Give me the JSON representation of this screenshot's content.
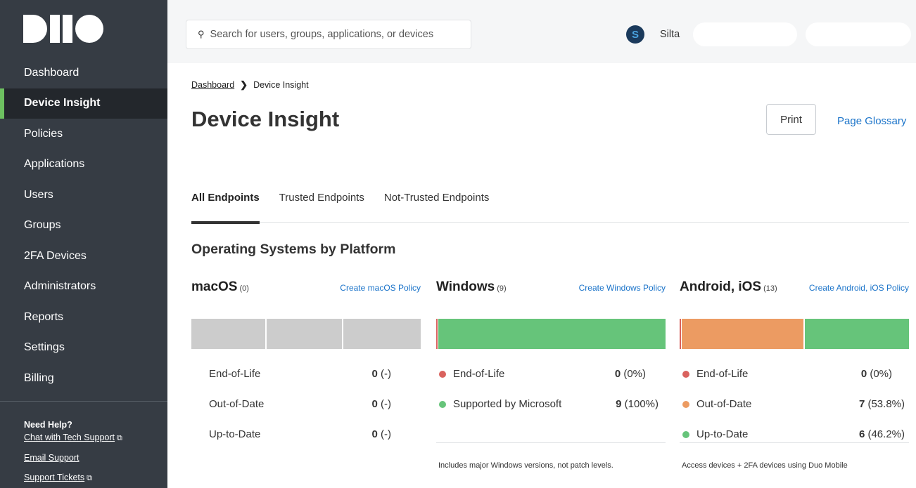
{
  "sidebar": {
    "items": [
      {
        "label": "Dashboard"
      },
      {
        "label": "Device Insight"
      },
      {
        "label": "Policies"
      },
      {
        "label": "Applications"
      },
      {
        "label": "Users"
      },
      {
        "label": "Groups"
      },
      {
        "label": "2FA Devices"
      },
      {
        "label": "Administrators"
      },
      {
        "label": "Reports"
      },
      {
        "label": "Settings"
      },
      {
        "label": "Billing"
      }
    ],
    "active": "Device Insight",
    "help": {
      "title": "Need Help?",
      "chat": "Chat with Tech Support",
      "email": "Email Support",
      "tickets": "Support Tickets"
    }
  },
  "topbar": {
    "search_placeholder": "Search for users, groups, applications, or devices",
    "user_name": "Silta",
    "avatar_letter": "S"
  },
  "breadcrumb": {
    "parent": "Dashboard",
    "current": "Device Insight"
  },
  "page": {
    "title": "Device Insight",
    "print_label": "Print",
    "glossary_label": "Page Glossary",
    "section_title": "Operating Systems by Platform"
  },
  "tabs": [
    {
      "label": "All Endpoints",
      "active": true
    },
    {
      "label": "Trusted Endpoints",
      "active": false
    },
    {
      "label": "Not-Trusted Endpoints",
      "active": false
    }
  ],
  "colors": {
    "end_of_life": "#d9625e",
    "out_of_date": "#ec9b62",
    "up_to_date": "#66c47a",
    "empty": "#cccccc",
    "accent": "#6dc060",
    "link": "#1a73c9"
  },
  "platforms": {
    "macos": {
      "name": "macOS",
      "count": "(0)",
      "policy": "Create macOS Policy",
      "rows": [
        {
          "label": "End-of-Life",
          "value": "0",
          "pct": "(-)"
        },
        {
          "label": "Out-of-Date",
          "value": "0",
          "pct": "(-)"
        },
        {
          "label": "Up-to-Date",
          "value": "0",
          "pct": "(-)"
        }
      ]
    },
    "windows": {
      "name": "Windows",
      "count": "(9)",
      "policy": "Create Windows Policy",
      "rows": [
        {
          "label": "End-of-Life",
          "value": "0",
          "pct": "(0%)"
        },
        {
          "label": "Supported by Microsoft",
          "value": "9",
          "pct": "(100%)"
        }
      ],
      "note": "Includes major Windows versions, not patch levels."
    },
    "mobile": {
      "name": "Android, iOS",
      "count": "(13)",
      "policy": "Create Android, iOS Policy",
      "rows": [
        {
          "label": "End-of-Life",
          "value": "0",
          "pct": "(0%)"
        },
        {
          "label": "Out-of-Date",
          "value": "7",
          "pct": "(53.8%)"
        },
        {
          "label": "Up-to-Date",
          "value": "6",
          "pct": "(46.2%)"
        }
      ],
      "note": "Access devices + 2FA devices using Duo Mobile"
    }
  }
}
